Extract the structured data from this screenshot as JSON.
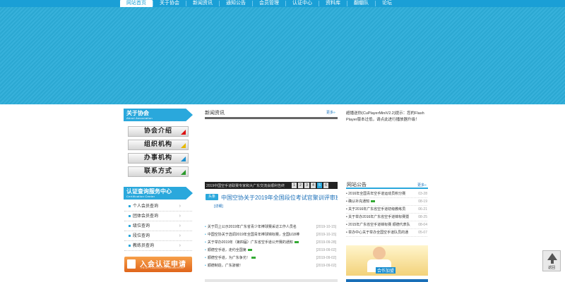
{
  "nav": {
    "items": [
      "网站首页",
      "关于协会",
      "新闻资讯",
      "通知公告",
      "会员管理",
      "认证中心",
      "资料库",
      "翻绷队",
      "论坛"
    ],
    "active_index": 0
  },
  "sidebar": {
    "about": {
      "title": "关于协会",
      "subtitle": "About  Association"
    },
    "about_menu": [
      "协会介绍",
      "组织机构",
      "办事机构",
      "联系方式"
    ],
    "about_menu_colors": [
      "#d11",
      "#e6b800",
      "#1a8fd0",
      "#2a9a2a"
    ],
    "cert": {
      "title": "认证查询服务中心",
      "subtitle": "Certification  Center"
    },
    "cert_items": [
      "个人会员查询",
      "团体会员查询",
      "级位查询",
      "段位查询",
      "教练员查询"
    ],
    "join": {
      "label": "入会认证申请",
      "sub": "THE APPLICATION FOR MEMBERSHIP"
    }
  },
  "news": {
    "title": "新闻资讯",
    "more": "更多",
    "slide_caption": "2019中国空手道联赛专家和大广东交流会顺利告终",
    "pages": [
      "1",
      "2",
      "3",
      "4",
      "5",
      "6"
    ],
    "active_page": 4,
    "headline_badge": "头条",
    "headline": "中国空协关于2019年全国段位考试官聚训评审班的补",
    "headline_detail": "[详细]",
    "list": [
      {
        "t": "关于同上公示2019年广东省青少年棒球赛采访工作人员名",
        "d": "[2019-10-15]",
        "new": false
      },
      {
        "t": "中国空协关于选调2019年全国青年棒球锦标赛，全国U18棒",
        "d": "[2019-10-15]",
        "new": false
      },
      {
        "t": "关于举办2019年（第四届）广东省空手道公开赛的通知",
        "d": "[2019-09-28]",
        "new": true
      },
      {
        "t": "顺德空手道，走约全国第",
        "d": "[2019-09-02]",
        "new": true
      },
      {
        "t": "顺德空手道，为广东争光！",
        "d": "[2019-09-02]",
        "new": true
      },
      {
        "t": "顺德制造，广东骄傲！",
        "d": "[2019-09-02]",
        "new": false
      }
    ]
  },
  "player_msg": "超播送你(CuPlayerMiniV2.2)提示：您的Flash Player版本过低，请点此进行播放器升级！",
  "announce": {
    "title": "网站公告",
    "more": "更多",
    "list": [
      {
        "t": "2016年全国青年空手道运动员积分赛",
        "d": "03-28"
      },
      {
        "t": "确认补充通知",
        "d": "08-19",
        "new": true
      },
      {
        "t": "关于2016年广东省空手道初级教练员",
        "d": "06-21"
      },
      {
        "t": "关于举办2016年广东省空手道锦标赛暨",
        "d": "08-25"
      },
      {
        "t": "2015年广东省空手道锦标赛 顺德代表队",
        "d": "08-04"
      },
      {
        "t": "举办中心关于举办全国空手道队员的通",
        "d": "05-07"
      }
    ]
  },
  "promo_tag": "合作加盟",
  "backtop_label": "返回"
}
